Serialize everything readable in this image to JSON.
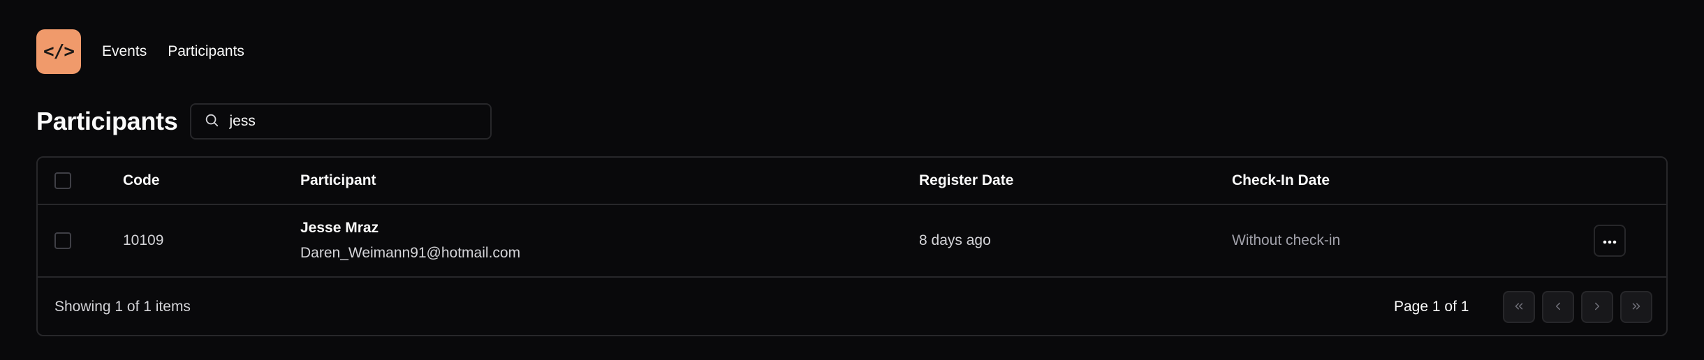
{
  "app": {
    "logo_text": "</>",
    "logo_color": "#f09a6b"
  },
  "nav": {
    "events": "Events",
    "participants": "Participants"
  },
  "page": {
    "title": "Participants"
  },
  "search": {
    "value": "jess",
    "icon": "search-icon"
  },
  "table": {
    "columns": {
      "code": "Code",
      "participant": "Participant",
      "register_date": "Register Date",
      "check_in_date": "Check-In Date"
    },
    "rows": [
      {
        "code": "10109",
        "name": "Jesse Mraz",
        "email": "Daren_Weimann91@hotmail.com",
        "register_date": "8 days ago",
        "check_in_date": "Without check-in"
      }
    ]
  },
  "footer": {
    "showing": "Showing 1 of 1 items",
    "page_info": "Page 1 of 1"
  }
}
